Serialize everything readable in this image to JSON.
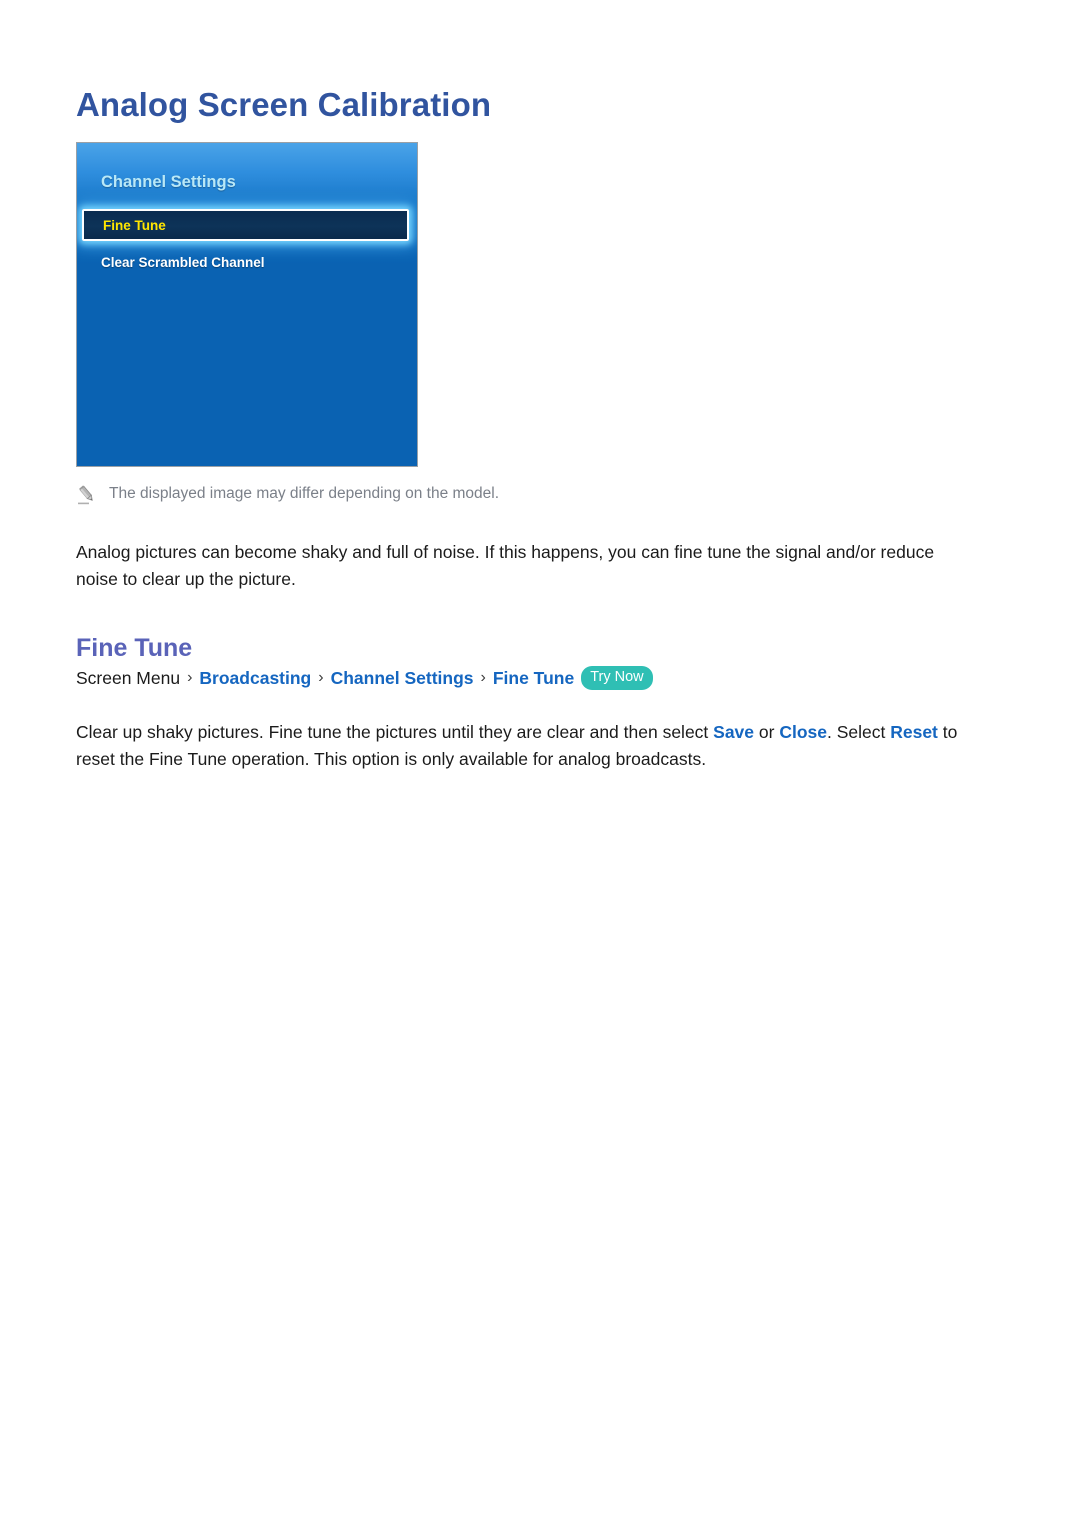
{
  "page": {
    "title": "Analog Screen Calibration"
  },
  "tv_panel": {
    "header": "Channel Settings",
    "items": [
      {
        "label": "Fine Tune",
        "selected": true
      },
      {
        "label": "Clear Scrambled Channel",
        "selected": false
      }
    ],
    "colors": {
      "panel_top_blue": "#4aa3e8",
      "panel_body_blue": "#0a62b2",
      "header_text": "#b9e8f7",
      "selected_text": "#ffe600",
      "selected_bg": "#0a2c50",
      "selected_border": "#ffffff",
      "item_text": "#ffffff",
      "panel_border": "#9aa0a6"
    }
  },
  "note": {
    "icon": "pencil-icon",
    "text": "The displayed image may differ depending on the model."
  },
  "intro_paragraph": "Analog pictures can become shaky and full of noise. If this happens, you can fine tune the signal and/or reduce noise to clear up the picture.",
  "section": {
    "heading": "Fine Tune"
  },
  "breadcrumb": {
    "root": "Screen Menu",
    "separator": "›",
    "links": [
      "Broadcasting",
      "Channel Settings",
      "Fine Tune"
    ],
    "badge": "Try Now",
    "badge_color": "#2fbfb4",
    "link_color": "#1566c0"
  },
  "detail_paragraph": {
    "part1": "Clear up shaky pictures. Fine tune the pictures until they are clear and then select ",
    "link_save": "Save",
    "part2": " or ",
    "link_close": "Close",
    "part3": ". Select ",
    "link_reset": "Reset",
    "part4": " to reset the Fine Tune operation. This option is only available for analog broadcasts."
  }
}
